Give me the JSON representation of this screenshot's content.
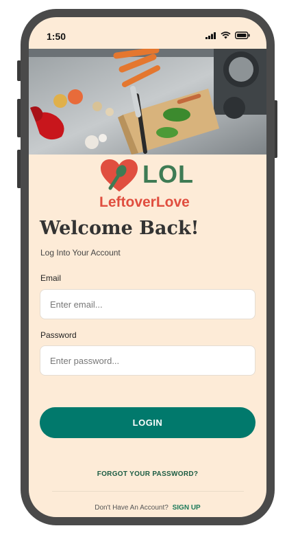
{
  "status_bar": {
    "time": "1:50",
    "icons": [
      "signal-icon",
      "wifi-icon",
      "battery-icon"
    ]
  },
  "hero": {
    "image": "kitchen-counter-vegetables"
  },
  "brand": {
    "short": "LOL",
    "name": "LeftoverLove",
    "colors": {
      "green": "#3e7b54",
      "red": "#e04e3f"
    }
  },
  "login": {
    "title": "Welcome Back!",
    "subtitle": "Log Into Your Account",
    "email_label": "Email",
    "email_placeholder": "Enter email...",
    "password_label": "Password",
    "password_placeholder": "Enter password...",
    "submit_label": "LOGIN",
    "forgot_label": "FORGOT YOUR PASSWORD?",
    "no_account_text": "Don't Have An Account?",
    "signup_label": "SIGN UP"
  },
  "theme": {
    "background": "#fdebd7",
    "accent": "#01796c",
    "frame": "#4a4a4a"
  }
}
